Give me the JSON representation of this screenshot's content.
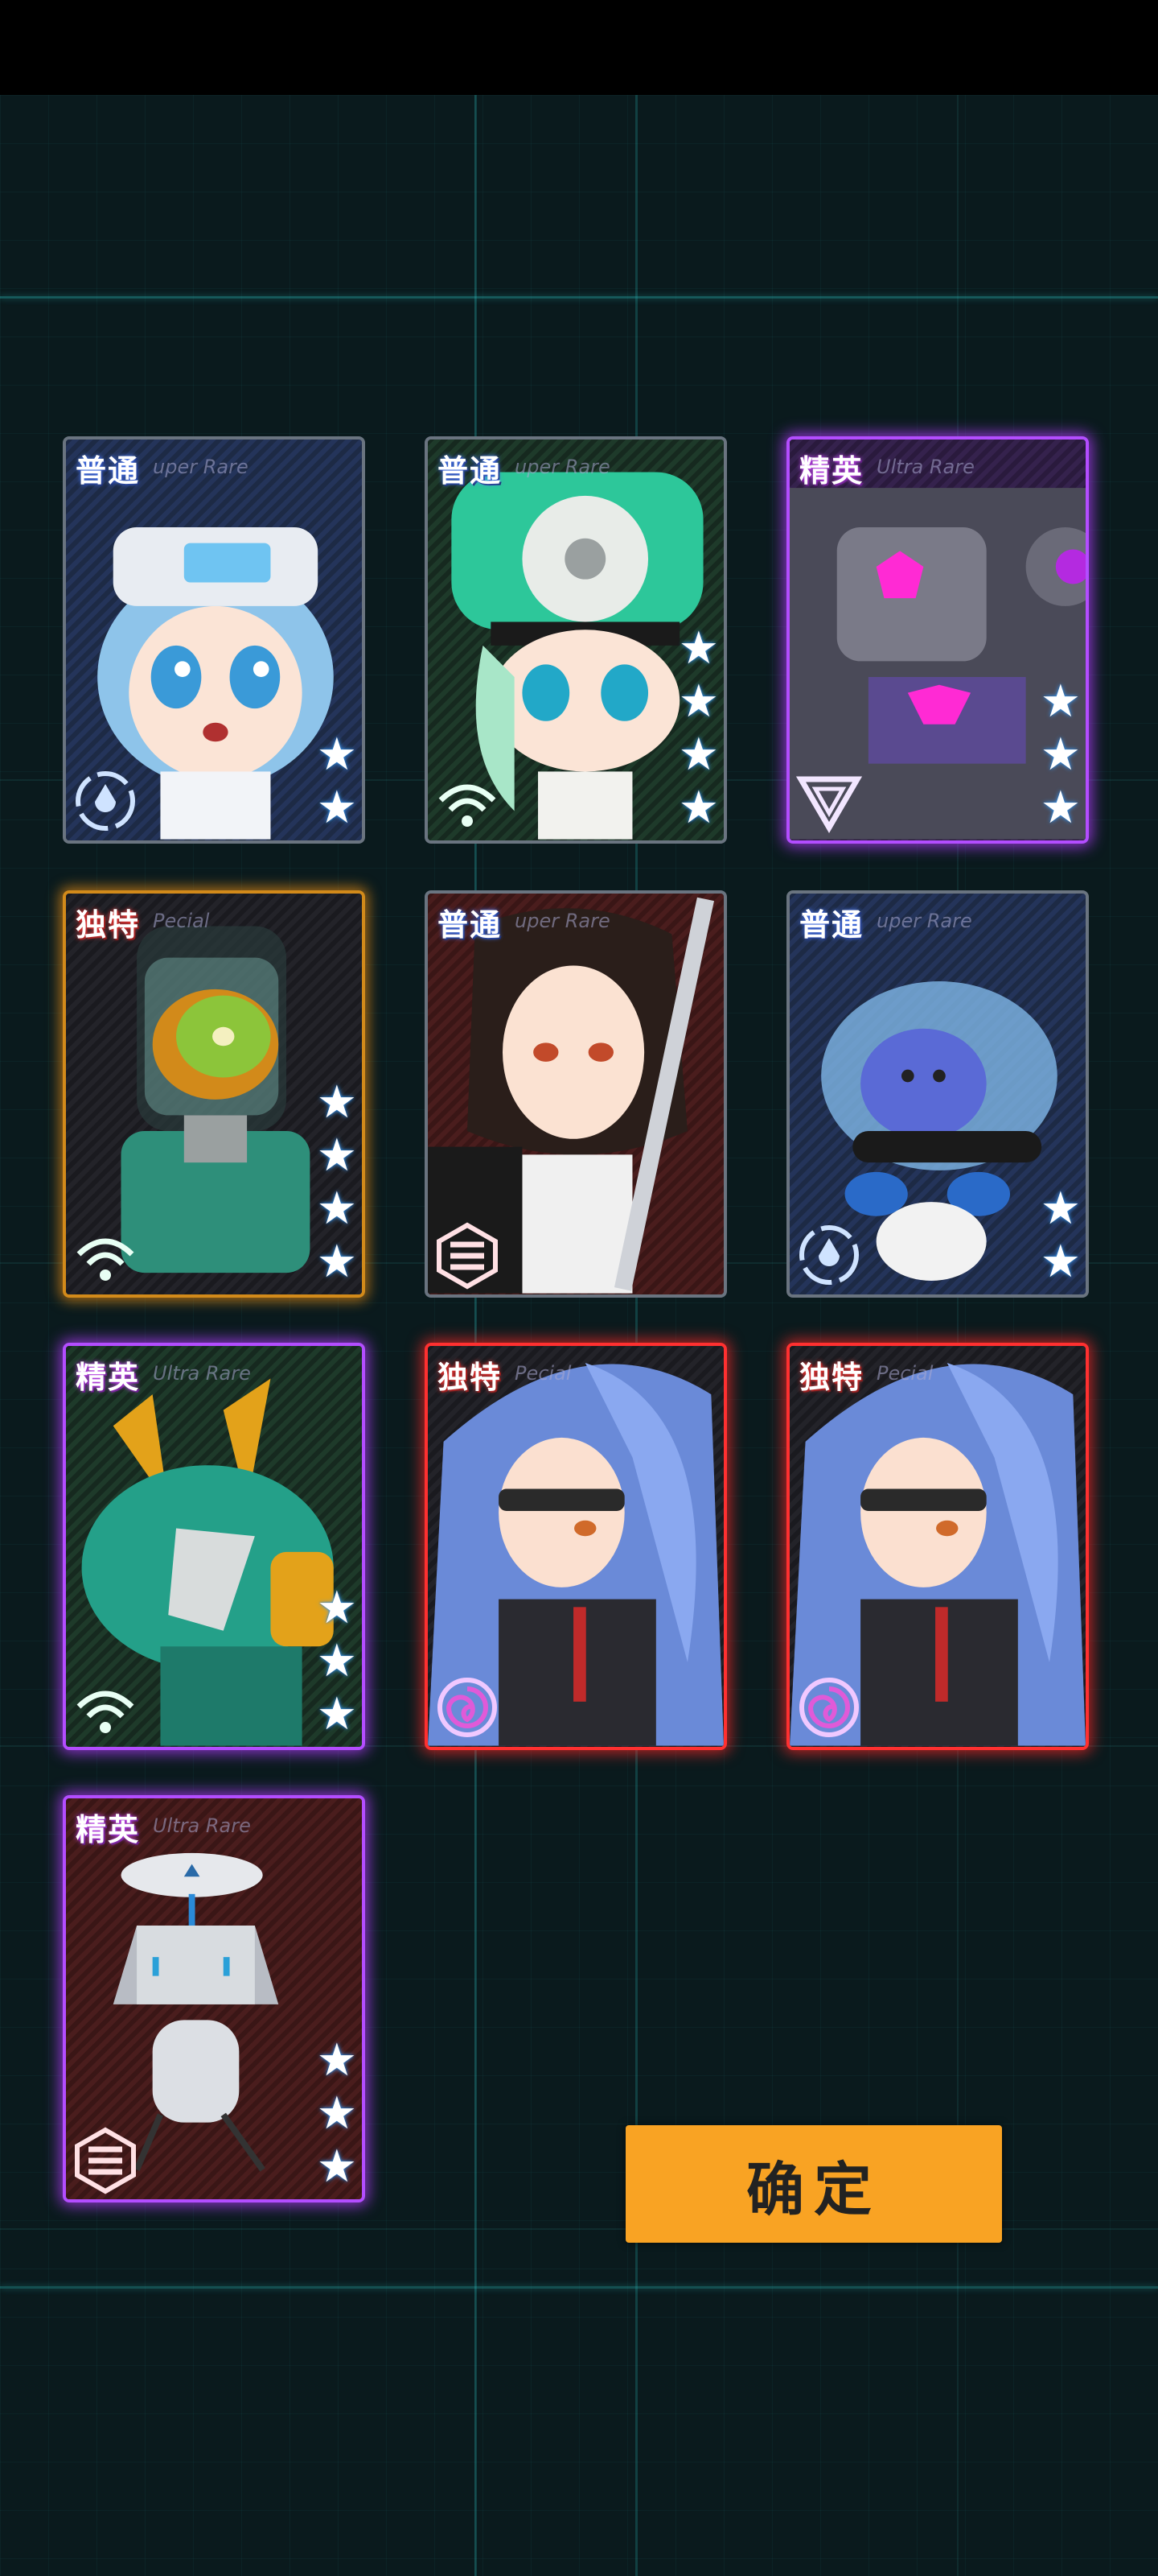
{
  "confirm_label": "确定",
  "cards": [
    {
      "rarity": "普通",
      "sub": "uper Rare",
      "stars": 2,
      "faction": "drop"
    },
    {
      "rarity": "普通",
      "sub": "uper Rare",
      "stars": 4,
      "faction": "wifi"
    },
    {
      "rarity": "精英",
      "sub": "Ultra Rare",
      "stars": 3,
      "faction": "triangle"
    },
    {
      "rarity": "独特",
      "sub": "Pecial",
      "stars": 4,
      "faction": "wifi"
    },
    {
      "rarity": "普通",
      "sub": "uper Rare",
      "stars": 0,
      "faction": "stripes"
    },
    {
      "rarity": "普通",
      "sub": "uper Rare",
      "stars": 2,
      "faction": "drop"
    },
    {
      "rarity": "精英",
      "sub": "Ultra Rare",
      "stars": 3,
      "faction": "wifi"
    },
    {
      "rarity": "独特",
      "sub": "Pecial",
      "stars": 0,
      "faction": "spiral"
    },
    {
      "rarity": "独特",
      "sub": "Pecial",
      "stars": 0,
      "faction": "spiral"
    },
    {
      "rarity": "精英",
      "sub": "Ultra Rare",
      "stars": 3,
      "faction": "stripes"
    }
  ]
}
